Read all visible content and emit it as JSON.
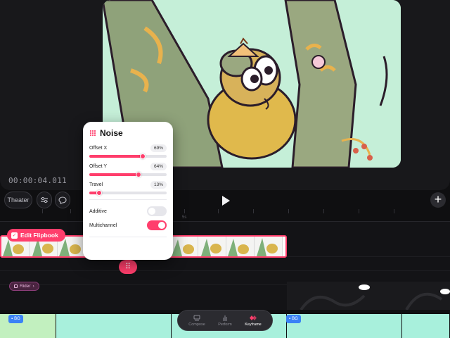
{
  "timecode": "00:00:04.011",
  "toolbar": {
    "theater_label": "Theater"
  },
  "ruler": {
    "label": "5s"
  },
  "flipbook": {
    "label": "Edit Flipbook"
  },
  "rider": {
    "label": "Rider"
  },
  "bg_tag": {
    "label": "BG"
  },
  "panel": {
    "title": "Noise",
    "params": [
      {
        "label": "Offset X",
        "value": "69%",
        "level": 0.69
      },
      {
        "label": "Offset Y",
        "value": "64%",
        "level": 0.64
      },
      {
        "label": "Travel",
        "value": "13%",
        "level": 0.13
      }
    ],
    "toggles": [
      {
        "label": "Additive",
        "on": false
      },
      {
        "label": "Multichannel",
        "on": true
      }
    ]
  },
  "modes": {
    "compose": "Compose",
    "perform": "Perform",
    "keyframe": "Keyframe",
    "active": "Keyframe"
  },
  "colors": {
    "accent": "#ff3e6c",
    "bg_track_a": "#c2f0bf",
    "bg_track_b": "#a8f0dc",
    "bg_tag": "#3a82f6"
  },
  "icons": {
    "adjust": "sliders-icon",
    "comment": "comment-icon",
    "play": "play-icon",
    "add": "plus-icon",
    "noise": "noise-grid-icon",
    "flipbook_check": "checkbox-icon",
    "compose": "layers-icon",
    "perform": "hand-icon",
    "keyframe": "keyframe-diamond-icon"
  }
}
